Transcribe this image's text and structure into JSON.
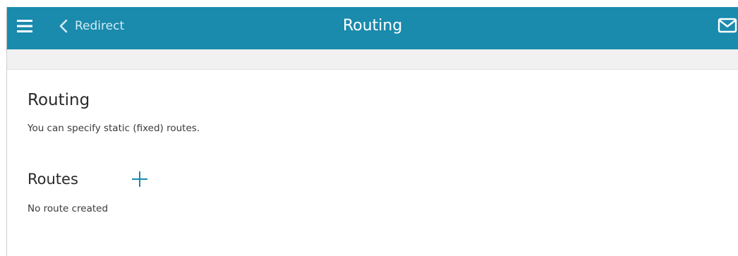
{
  "header": {
    "back_label": "Redirect",
    "title": "Routing",
    "accent_color": "#1a8aad",
    "icons": {
      "menu": "hamburger-menu-icon",
      "back": "chevron-left-icon",
      "notifications": "mail-icon"
    }
  },
  "main": {
    "heading": "Routing",
    "description": "You can specify static (fixed) routes.",
    "routes": {
      "heading": "Routes",
      "add_icon": "plus-icon",
      "empty_text": "No route created"
    }
  }
}
